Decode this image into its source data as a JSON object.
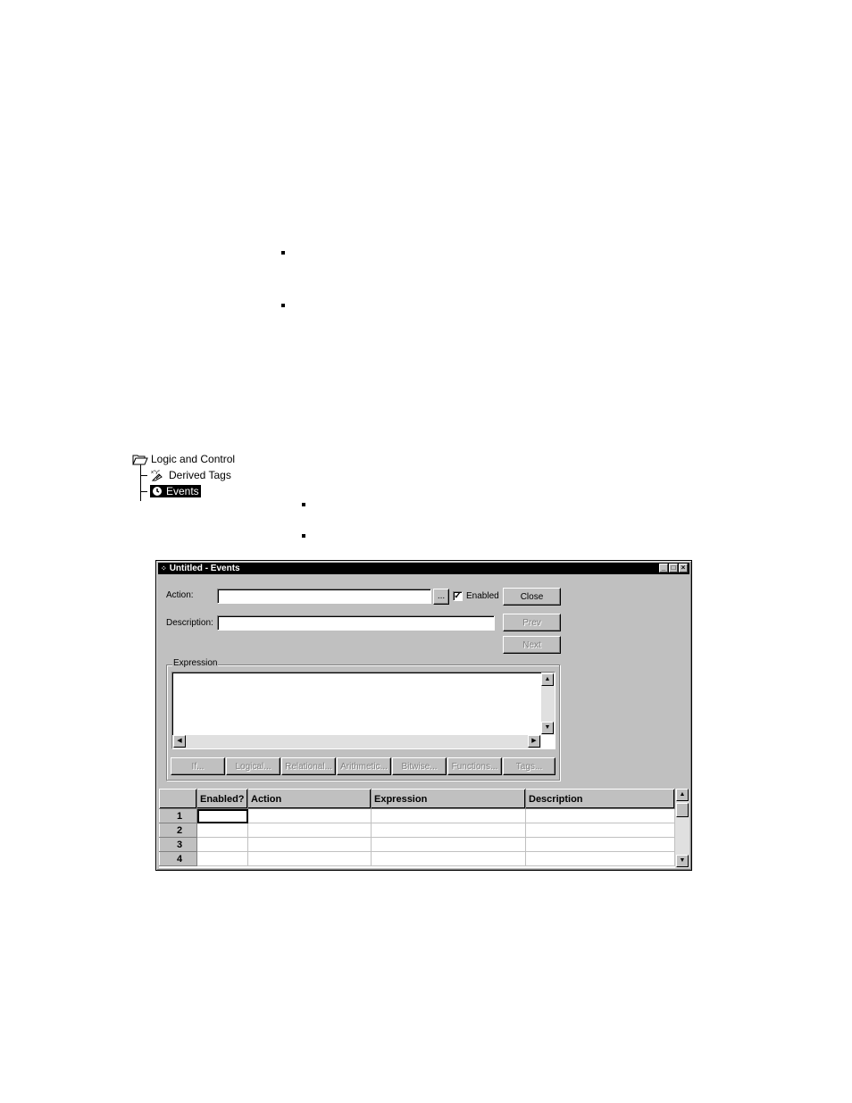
{
  "tree": {
    "root_label": "Logic and Control",
    "items": [
      {
        "label": "Derived Tags",
        "icon": "derived-tags-icon"
      },
      {
        "label": "Events",
        "icon": "events-icon",
        "selected": true
      }
    ]
  },
  "window": {
    "title": "Untitled - Events",
    "title_buttons": {
      "minimize": "_",
      "maximize": "□",
      "close": "×"
    },
    "action_label": "Action:",
    "action_value": "",
    "browse_label": "...",
    "enabled_label": "Enabled",
    "enabled_checked": "✓",
    "description_label": "Description:",
    "description_value": "",
    "close_label": "Close",
    "prev_label": "Prev",
    "next_label": "Next",
    "expression_group_label": "Expression",
    "expression_value": "",
    "expr_buttons": [
      "If...",
      "Logical...",
      "Relational...",
      "Arithmetic...",
      "Bitwise...",
      "Functions...",
      "Tags..."
    ],
    "grid": {
      "columns": [
        "",
        "Enabled?",
        "Action",
        "Expression",
        "Description"
      ],
      "rows": [
        {
          "num": "1",
          "enabled": "",
          "action": "",
          "expression": "",
          "description": ""
        },
        {
          "num": "2",
          "enabled": "",
          "action": "",
          "expression": "",
          "description": ""
        },
        {
          "num": "3",
          "enabled": "",
          "action": "",
          "expression": "",
          "description": ""
        },
        {
          "num": "4",
          "enabled": "",
          "action": "",
          "expression": "",
          "description": ""
        }
      ]
    }
  }
}
